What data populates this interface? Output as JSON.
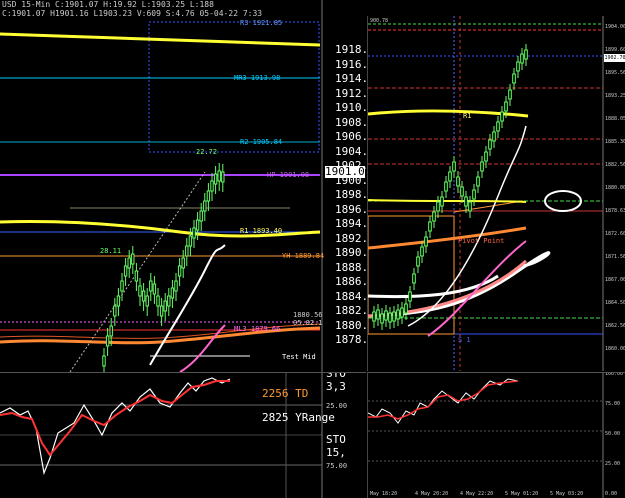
{
  "header": {
    "line1": "USD 15-Min  C:1901.07 H:19.92 L:1903.25 L:188",
    "line2": "C:1901.07 H1901.16 L1903.23 V:609 S:4.76 05-04-22 7:33"
  },
  "left_price_axis": [
    "1918.00",
    "1916.00",
    "1914.00",
    "1912.00",
    "1910.00",
    "1908.00",
    "1906.00",
    "1904.00",
    "1902.00",
    "1900.00",
    "1898.00",
    "1896.00",
    "1894.00",
    "1892.00",
    "1890.00",
    "1888.00",
    "1886.00",
    "1884.00",
    "1882.00",
    "1880.00",
    "1878.00"
  ],
  "current_price": "1901.07",
  "levels": {
    "r3": "R3 1921.85",
    "mr3": "MR3 1913.98",
    "r2": "R2 1905.84",
    "hp": "HP 1901.08",
    "r1": "R1 1893.40",
    "yh": "YH 1889.84",
    "ml3": "ML3 1879.66",
    "small1": "1880.56",
    "small2": "05.02.1",
    "test_mid": "Test Mid",
    "peak_label": "22.72",
    "swing_label": "28.11"
  },
  "oscillator": {
    "td": "2256 TD",
    "yrange": "2825 YRange",
    "sto": "STO  15,",
    "sto_top": "STO  3,3",
    "level25": "25.00",
    "level75": "75.00"
  },
  "right_chart": {
    "top_label": "900.78",
    "price_axis": [
      "1904.00",
      "1899.60",
      "1895.56",
      "1893.25",
      "1888.05",
      "1885.30",
      "1882.56",
      "1880.00",
      "1878.63",
      "1872.60",
      "1871.56",
      "1867.00",
      "1864.50",
      "1862.56",
      "1860.00"
    ],
    "price_box": "1902.70",
    "pivot_label": "Pivot Point",
    "s1_label": "S 1",
    "small_label": "R1",
    "dates": [
      "May 18:20",
      "4 May 20:20",
      "4 May 22:20",
      "5 May 01:20",
      "5 May 03:20"
    ],
    "osc_levels": [
      "100.00",
      "75.00",
      "50.00",
      "25.00",
      "0.00"
    ]
  },
  "colors": {
    "ma_yellow": "#ffff33",
    "ma_orange": "#ff9933",
    "ma_pink": "#ff66cc",
    "ma_white": "#ffffff",
    "candle_green": "#66ff66",
    "stoch_red": "#ff3333"
  }
}
